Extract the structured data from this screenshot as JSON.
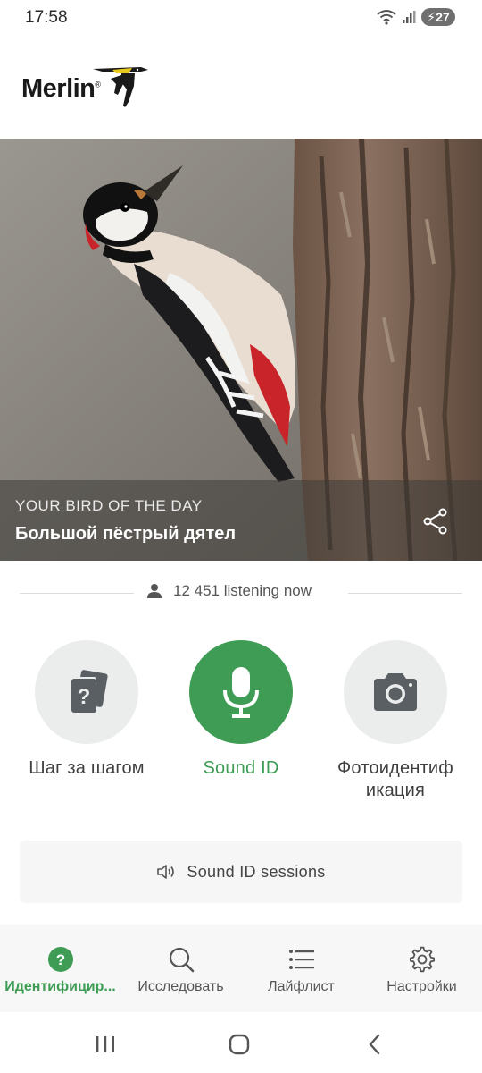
{
  "status_bar": {
    "time": "17:58",
    "battery": "27"
  },
  "app": {
    "logo_text": "Merlin",
    "logo_mark": "®"
  },
  "hero": {
    "kicker": "YOUR BIRD OF THE DAY",
    "title": "Большой пёстрый дятел"
  },
  "listening": {
    "text": "12 451 listening now"
  },
  "actions": [
    {
      "label": "Шаг за шагом",
      "icon": "question-cards-icon"
    },
    {
      "label": "Sound ID",
      "icon": "microphone-icon",
      "active": true
    },
    {
      "label": "Фотоидентиф\nикация",
      "icon": "camera-icon"
    }
  ],
  "sessions": {
    "label": "Sound ID sessions"
  },
  "bottom_nav": [
    {
      "label": "Идентифицир...",
      "icon": "identify-icon",
      "active": true
    },
    {
      "label": "Исследовать",
      "icon": "search-icon"
    },
    {
      "label": "Лайфлист",
      "icon": "list-icon"
    },
    {
      "label": "Настройки",
      "icon": "gear-icon"
    }
  ],
  "colors": {
    "accent": "#3e9c55",
    "circle": "#ebedec",
    "text": "#3f3f3f"
  }
}
